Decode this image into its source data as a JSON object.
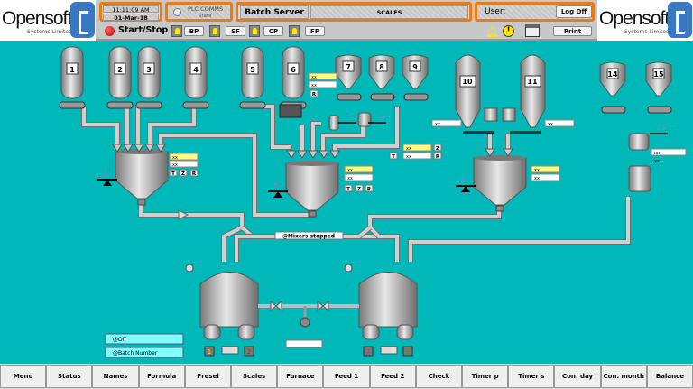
{
  "logo": {
    "word": "Opensoft",
    "sub": "Systems Limited"
  },
  "header": {
    "time": "11:11:09 AM",
    "date": "01-Mar-18",
    "plc_title": "PLC COMMS",
    "plc_state": "State",
    "server": "Batch Server",
    "scales": "SCALES",
    "user_label": "User:",
    "logoff": "Log Off",
    "start_stop": "Start/Stop",
    "feed_buttons": [
      "BP",
      "SF",
      "CP",
      "FP"
    ],
    "print": "Print",
    "icons": [
      "alarm-bell-icon",
      "warning-icon",
      "printer-icon"
    ]
  },
  "process": {
    "silos": [
      "1",
      "2",
      "3",
      "4",
      "5",
      "6",
      "7",
      "8",
      "9",
      "10",
      "11",
      "14",
      "15"
    ],
    "scales": [
      "1",
      "5",
      "2",
      "4",
      "3",
      "6"
    ],
    "value_placeholder": "xx",
    "letters": {
      "t": "T",
      "z": "Z",
      "r": "R"
    },
    "status_mixers": "@Mixers stopped",
    "status_off": "@Off",
    "status_batch": "@Batch Number",
    "tank_tags": [
      "1",
      "2",
      "3",
      "4"
    ],
    "tank_tag_colors": [
      "#ffee00",
      "#2244ff",
      "#cc22cc",
      "#22aa22"
    ],
    "background_color": "#00b8b8",
    "highlight_color": "#ffff80"
  },
  "nav": [
    "Menu",
    "Status",
    "Names",
    "Formula",
    "Presel",
    "Scales",
    "Furnace",
    "Feed 1",
    "Feed 2",
    "Check",
    "Timer p",
    "Timer s",
    "Con. day",
    "Con. month",
    "Balance"
  ]
}
